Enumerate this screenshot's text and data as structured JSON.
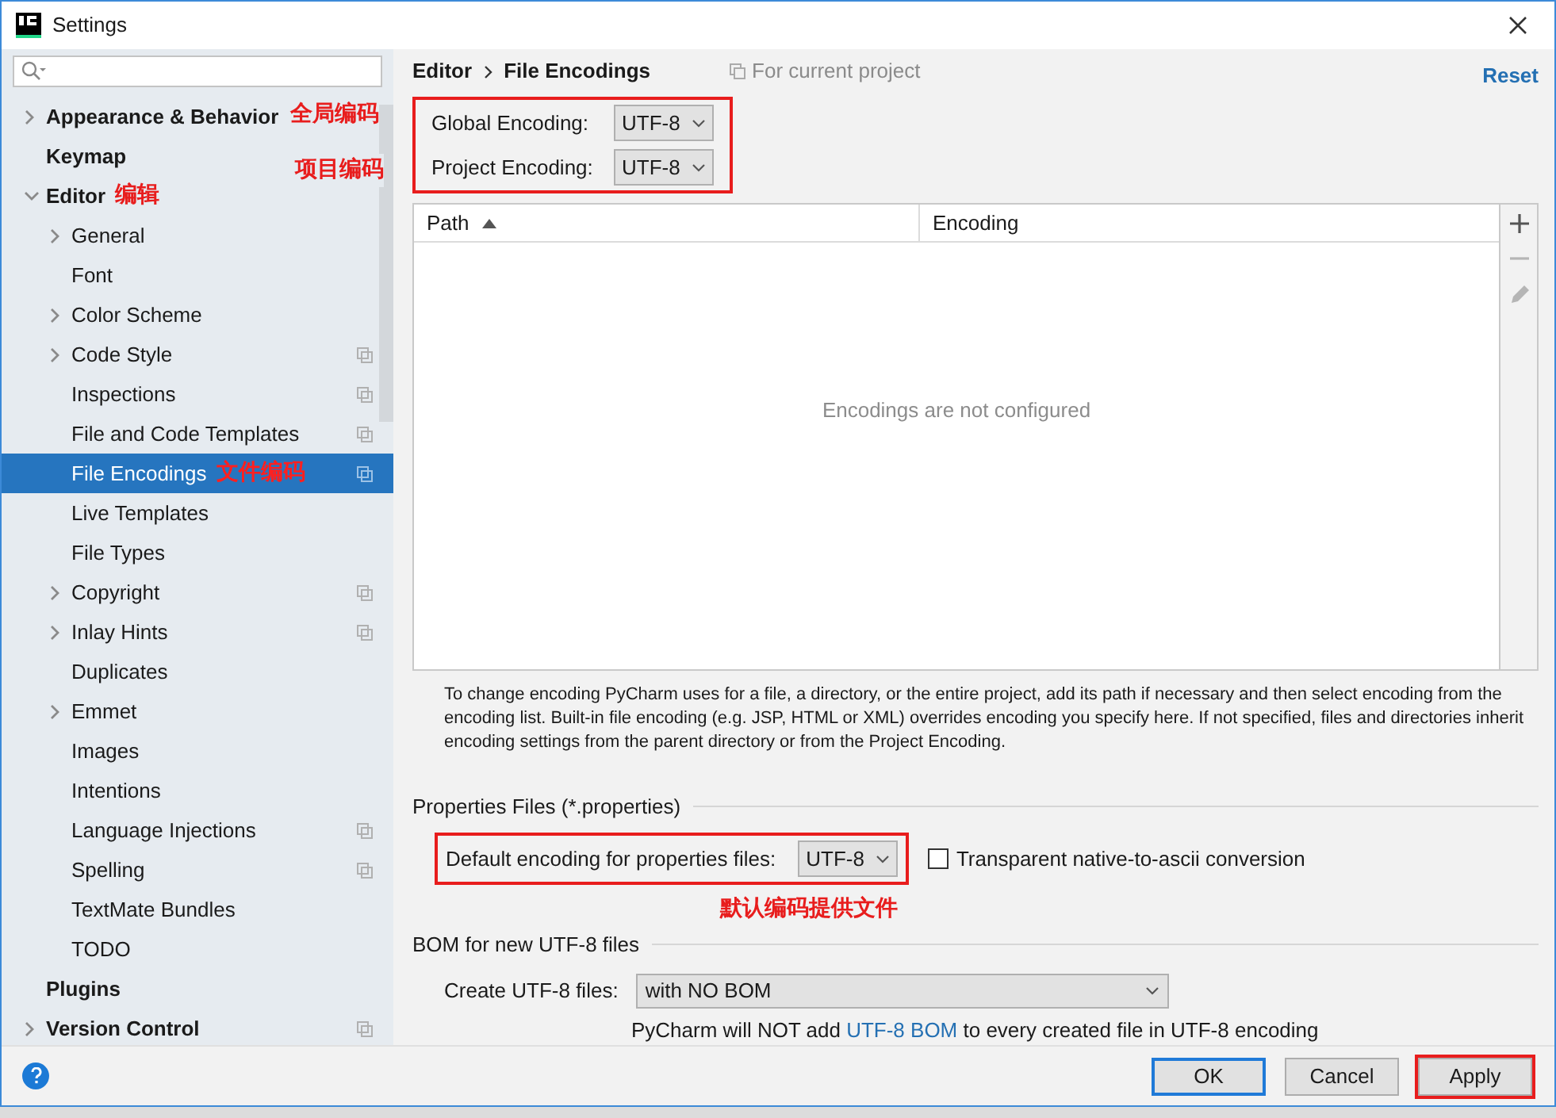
{
  "window": {
    "title": "Settings"
  },
  "sidebar": {
    "items": [
      {
        "label": "Appearance & Behavior",
        "kind": "group",
        "expanded": false,
        "selected": false,
        "shared": false
      },
      {
        "label": "Keymap",
        "kind": "leaf",
        "selected": false,
        "shared": false
      },
      {
        "label": "Editor",
        "kind": "group",
        "expanded": true,
        "selected": false,
        "shared": false,
        "note": "编辑",
        "children": [
          {
            "label": "General",
            "kind": "group",
            "expanded": false,
            "selected": false,
            "shared": false
          },
          {
            "label": "Font",
            "kind": "leaf",
            "selected": false,
            "shared": false
          },
          {
            "label": "Color Scheme",
            "kind": "group",
            "expanded": false,
            "selected": false,
            "shared": false
          },
          {
            "label": "Code Style",
            "kind": "group",
            "expanded": false,
            "selected": false,
            "shared": true
          },
          {
            "label": "Inspections",
            "kind": "leaf",
            "selected": false,
            "shared": true
          },
          {
            "label": "File and Code Templates",
            "kind": "leaf",
            "selected": false,
            "shared": true
          },
          {
            "label": "File Encodings",
            "kind": "leaf",
            "selected": true,
            "shared": true,
            "note": "文件编码"
          },
          {
            "label": "Live Templates",
            "kind": "leaf",
            "selected": false,
            "shared": false
          },
          {
            "label": "File Types",
            "kind": "leaf",
            "selected": false,
            "shared": false
          },
          {
            "label": "Copyright",
            "kind": "group",
            "expanded": false,
            "selected": false,
            "shared": true
          },
          {
            "label": "Inlay Hints",
            "kind": "group",
            "expanded": false,
            "selected": false,
            "shared": true
          },
          {
            "label": "Duplicates",
            "kind": "leaf",
            "selected": false,
            "shared": false
          },
          {
            "label": "Emmet",
            "kind": "group",
            "expanded": false,
            "selected": false,
            "shared": false
          },
          {
            "label": "Images",
            "kind": "leaf",
            "selected": false,
            "shared": false
          },
          {
            "label": "Intentions",
            "kind": "leaf",
            "selected": false,
            "shared": false
          },
          {
            "label": "Language Injections",
            "kind": "leaf",
            "selected": false,
            "shared": true
          },
          {
            "label": "Spelling",
            "kind": "leaf",
            "selected": false,
            "shared": true
          },
          {
            "label": "TextMate Bundles",
            "kind": "leaf",
            "selected": false,
            "shared": false
          },
          {
            "label": "TODO",
            "kind": "leaf",
            "selected": false,
            "shared": false
          }
        ]
      },
      {
        "label": "Plugins",
        "kind": "leaf",
        "selected": false,
        "shared": false
      },
      {
        "label": "Version Control",
        "kind": "group",
        "expanded": false,
        "selected": false,
        "shared": true
      }
    ]
  },
  "breadcrumb": [
    "Editor",
    "File Encodings"
  ],
  "scope_note": "For current project",
  "reset": "Reset",
  "encodings": [
    {
      "label": "Global Encoding:",
      "value": "UTF-8",
      "note": "全局编码"
    },
    {
      "label": "Project Encoding:",
      "value": "UTF-8",
      "note": "项目编码"
    }
  ],
  "table": {
    "columns": [
      {
        "label": "Path",
        "sorted": true
      },
      {
        "label": "Encoding",
        "sorted": false
      }
    ],
    "empty_text": "Encodings are not configured"
  },
  "description": "To change encoding PyCharm uses for a file, a directory, or the entire project, add its path if necessary and then select encoding from the encoding list. Built-in file encoding (e.g. JSP, HTML or XML) overrides encoding you specify here. If not specified, files and directories inherit encoding settings from the parent directory or from the Project Encoding.",
  "properties": {
    "title": "Properties Files (*.properties)",
    "label": "Default encoding for properties files:",
    "value": "UTF-8",
    "checkbox": {
      "label": "Transparent native-to-ascii conversion",
      "checked": false
    },
    "note": "默认编码提供文件"
  },
  "bom": {
    "title": "BOM for new UTF-8 files",
    "label": "Create UTF-8 files:",
    "value": "with NO BOM",
    "hint": [
      "PyCharm will NOT add ",
      "UTF-8 BOM",
      " to every created file in UTF-8 encoding"
    ]
  },
  "buttons": [
    {
      "label": "OK",
      "default": true,
      "highlighted": false
    },
    {
      "label": "Cancel",
      "default": false,
      "highlighted": false
    },
    {
      "label": "Apply",
      "default": false,
      "highlighted": true
    }
  ]
}
